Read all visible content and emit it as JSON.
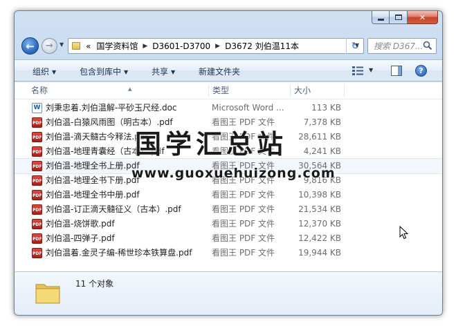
{
  "breadcrumb": {
    "overflow": "«",
    "items": [
      "国学资料馆",
      "D3601-D3700",
      "D3672 刘伯温11本"
    ]
  },
  "search": {
    "placeholder": "搜索 D367..."
  },
  "toolbar": {
    "organize": "组织",
    "include_in_library": "包含到库中",
    "share": "共享",
    "new_folder": "新建文件夹"
  },
  "columns": {
    "name": "名称",
    "type": "类型",
    "size": "大小"
  },
  "files": [
    {
      "name": "刘秉忠着.刘伯温解-平砂玉尺经.doc",
      "type": "Microsoft Word ...",
      "size": "113 KB",
      "icon": "word-doc-icon"
    },
    {
      "name": "刘伯温-白猿风雨图（明古本）.pdf",
      "type": "看图王 PDF 文件",
      "size": "7,378 KB",
      "icon": "pdf-icon"
    },
    {
      "name": "刘伯温-滴天髓古今释法.pdf",
      "type": "看图王 PDF 文件",
      "size": "28,611 KB",
      "icon": "pdf-icon"
    },
    {
      "name": "刘伯温-地理青囊经（古本）.pdf",
      "type": "看图王 PDF 文件",
      "size": "4,241 KB",
      "icon": "pdf-icon"
    },
    {
      "name": "刘伯温-地理全书上册.pdf",
      "type": "看图王 PDF 文件",
      "size": "30,564 KB",
      "icon": "pdf-icon"
    },
    {
      "name": "刘伯温-地理全书下册.pdf",
      "type": "看图王 PDF 文件",
      "size": "9,816 KB",
      "icon": "pdf-icon"
    },
    {
      "name": "刘伯温-地理全书中册.pdf",
      "type": "看图王 PDF 文件",
      "size": "10,398 KB",
      "icon": "pdf-icon"
    },
    {
      "name": "刘伯温-订正滴天髓征义（古本）.pdf",
      "type": "看图王 PDF 文件",
      "size": "21,534 KB",
      "icon": "pdf-icon"
    },
    {
      "name": "刘伯温-烧饼歌.pdf",
      "type": "看图王 PDF 文件",
      "size": "12,370 KB",
      "icon": "pdf-icon"
    },
    {
      "name": "刘伯温-四弹子.pdf",
      "type": "看图王 PDF 文件",
      "size": "12,422 KB",
      "icon": "pdf-icon"
    },
    {
      "name": "刘伯温着.金灵子编-稀世珍本铁算盘.pdf",
      "type": "看图王 PDF 文件",
      "size": "19,944 KB",
      "icon": "pdf-icon"
    }
  ],
  "status": "11 个对象",
  "watermark": {
    "text": "国学汇总站",
    "url": "www.guoxuehuizong.com"
  },
  "colors": {
    "window_frame": "#bcd3ec",
    "selection": "#d8e6f6",
    "pdf_icon": "#c8302a"
  }
}
